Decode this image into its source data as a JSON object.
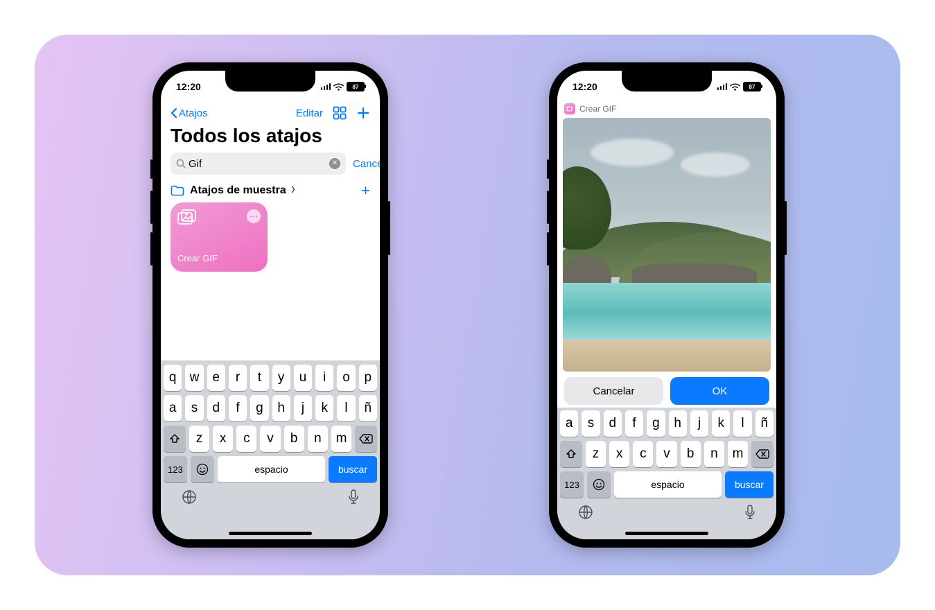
{
  "status": {
    "time": "12:20",
    "battery": "87"
  },
  "phone1": {
    "nav": {
      "back": "Atajos",
      "edit": "Editar"
    },
    "title": "Todos los atajos",
    "search": {
      "value": "Gif",
      "cancel": "Cancelar"
    },
    "section": {
      "label": "Atajos de muestra"
    },
    "tile": {
      "label": "Crear GIF"
    }
  },
  "phone2": {
    "header": "Crear GIF",
    "buttons": {
      "cancel": "Cancelar",
      "ok": "OK"
    }
  },
  "keyboard": {
    "row1": [
      "q",
      "w",
      "e",
      "r",
      "t",
      "y",
      "u",
      "i",
      "o",
      "p"
    ],
    "row2": [
      "a",
      "s",
      "d",
      "f",
      "g",
      "h",
      "j",
      "k",
      "l",
      "ñ"
    ],
    "row3": [
      "z",
      "x",
      "c",
      "v",
      "b",
      "n",
      "m"
    ],
    "num": "123",
    "space": "espacio",
    "action": "buscar"
  }
}
